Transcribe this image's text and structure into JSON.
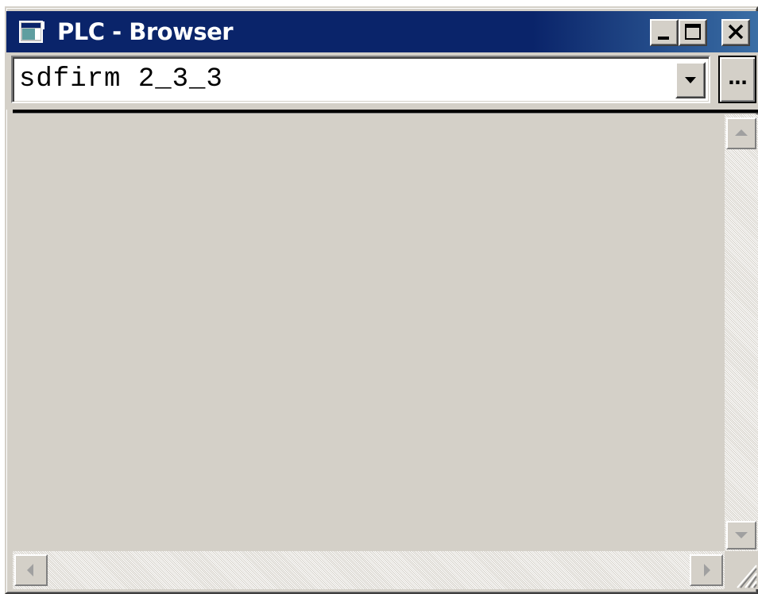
{
  "window": {
    "title": "PLC - Browser",
    "icon": "app-window-icon"
  },
  "caption_buttons": {
    "minimize_icon": "minimize-icon",
    "maximize_icon": "maximize-icon",
    "close_icon": "close-icon"
  },
  "address": {
    "value": "sdfirm 2_3_3",
    "dropdown_icon": "chevron-down-icon",
    "browse_label": "..."
  },
  "scrollbars": {
    "vertical": {
      "up_icon": "arrow-up-icon",
      "down_icon": "arrow-down-icon"
    },
    "horizontal": {
      "left_icon": "arrow-left-icon",
      "right_icon": "arrow-right-icon"
    },
    "grip_icon": "size-grip-icon"
  },
  "colors": {
    "titlebar": "#0a246a",
    "face": "#d4d0c8",
    "text": "#000000"
  }
}
